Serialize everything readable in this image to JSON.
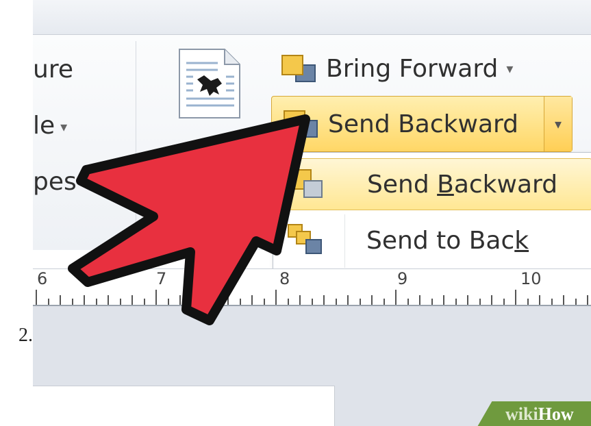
{
  "step": {
    "number": "2."
  },
  "ribbon": {
    "left_labels": [
      "ure",
      "le",
      "pes"
    ],
    "left_dropdown_caret": "▾"
  },
  "arrange": {
    "bring_forward": {
      "label": "Bring Forward",
      "caret": "▾"
    },
    "send_backward": {
      "label": "Send Backward",
      "caret": "▾"
    }
  },
  "send_menu": {
    "items": [
      {
        "label_before": "Send ",
        "mnemonic": "B",
        "label_after": "ackward"
      },
      {
        "label_before": "Send to Bac",
        "mnemonic": "k",
        "label_after": ""
      }
    ]
  },
  "ruler": {
    "labels": [
      "6",
      "7",
      "8",
      "9",
      "10"
    ]
  },
  "watermark": {
    "part1": "wiki",
    "part2": "How"
  },
  "colors": {
    "arrow": "#e8303f",
    "highlight": "#ffd766",
    "watermark": "#6f9a3e"
  }
}
